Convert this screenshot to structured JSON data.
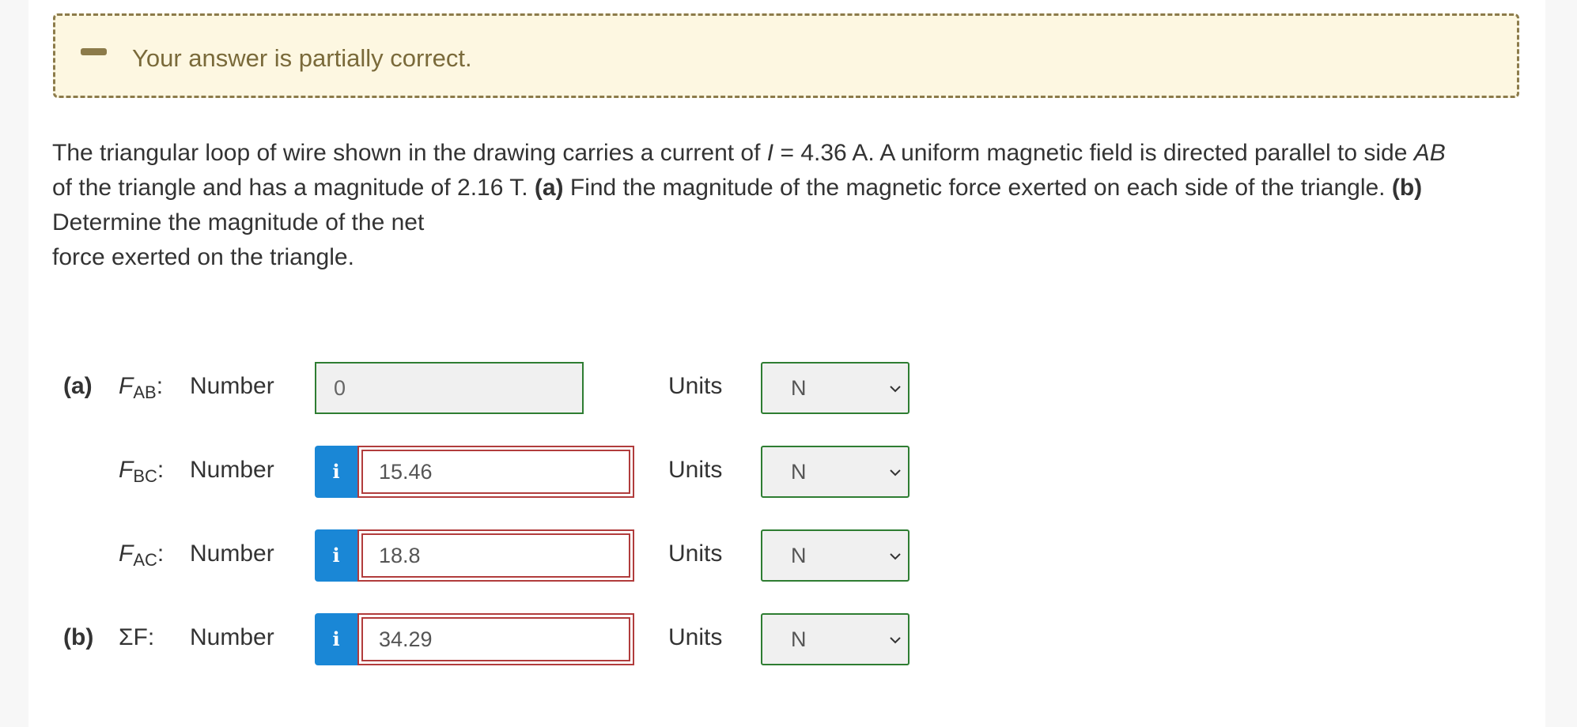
{
  "notice": {
    "message": "Your answer is partially correct.",
    "icon": "minus-icon"
  },
  "question": {
    "p1": "The triangular loop of wire shown in the drawing carries a current of ",
    "p1_var": "I",
    "p2": " = 4.36 A. A uniform magnetic field is directed parallel to side ",
    "p2_var": "AB",
    "p3": " of the triangle and has a magnitude of 2.16 T. ",
    "a_label": "(a)",
    "p4": " Find the magnitude of the magnetic force exerted on each side of the triangle. ",
    "b_label": "(b)",
    "p5": " Determine the magnitude of the net",
    "p6": "force exerted on the triangle."
  },
  "rows": [
    {
      "part": "(a)",
      "var": "F",
      "sub": "AB",
      "colon": ":",
      "number_label": "Number",
      "value": "0",
      "status": "correct",
      "units_label": "Units",
      "unit": "N"
    },
    {
      "part": "",
      "var": "F",
      "sub": "BC",
      "colon": ":",
      "number_label": "Number",
      "value": "15.46",
      "status": "incorrect",
      "units_label": "Units",
      "unit": "N"
    },
    {
      "part": "",
      "var": "F",
      "sub": "AC",
      "colon": ":",
      "number_label": "Number",
      "value": "18.8",
      "status": "incorrect",
      "units_label": "Units",
      "unit": "N"
    },
    {
      "part": "(b)",
      "var": "ΣF",
      "sub": "",
      "colon": ":",
      "number_label": "Number",
      "value": "34.29",
      "status": "incorrect",
      "units_label": "Units",
      "unit": "N"
    }
  ],
  "info_glyph": "i",
  "colors": {
    "correct": "#2e7d32",
    "incorrect": "#b13c3c",
    "info": "#1a87d6",
    "notice_bg": "#fdf7e1"
  }
}
